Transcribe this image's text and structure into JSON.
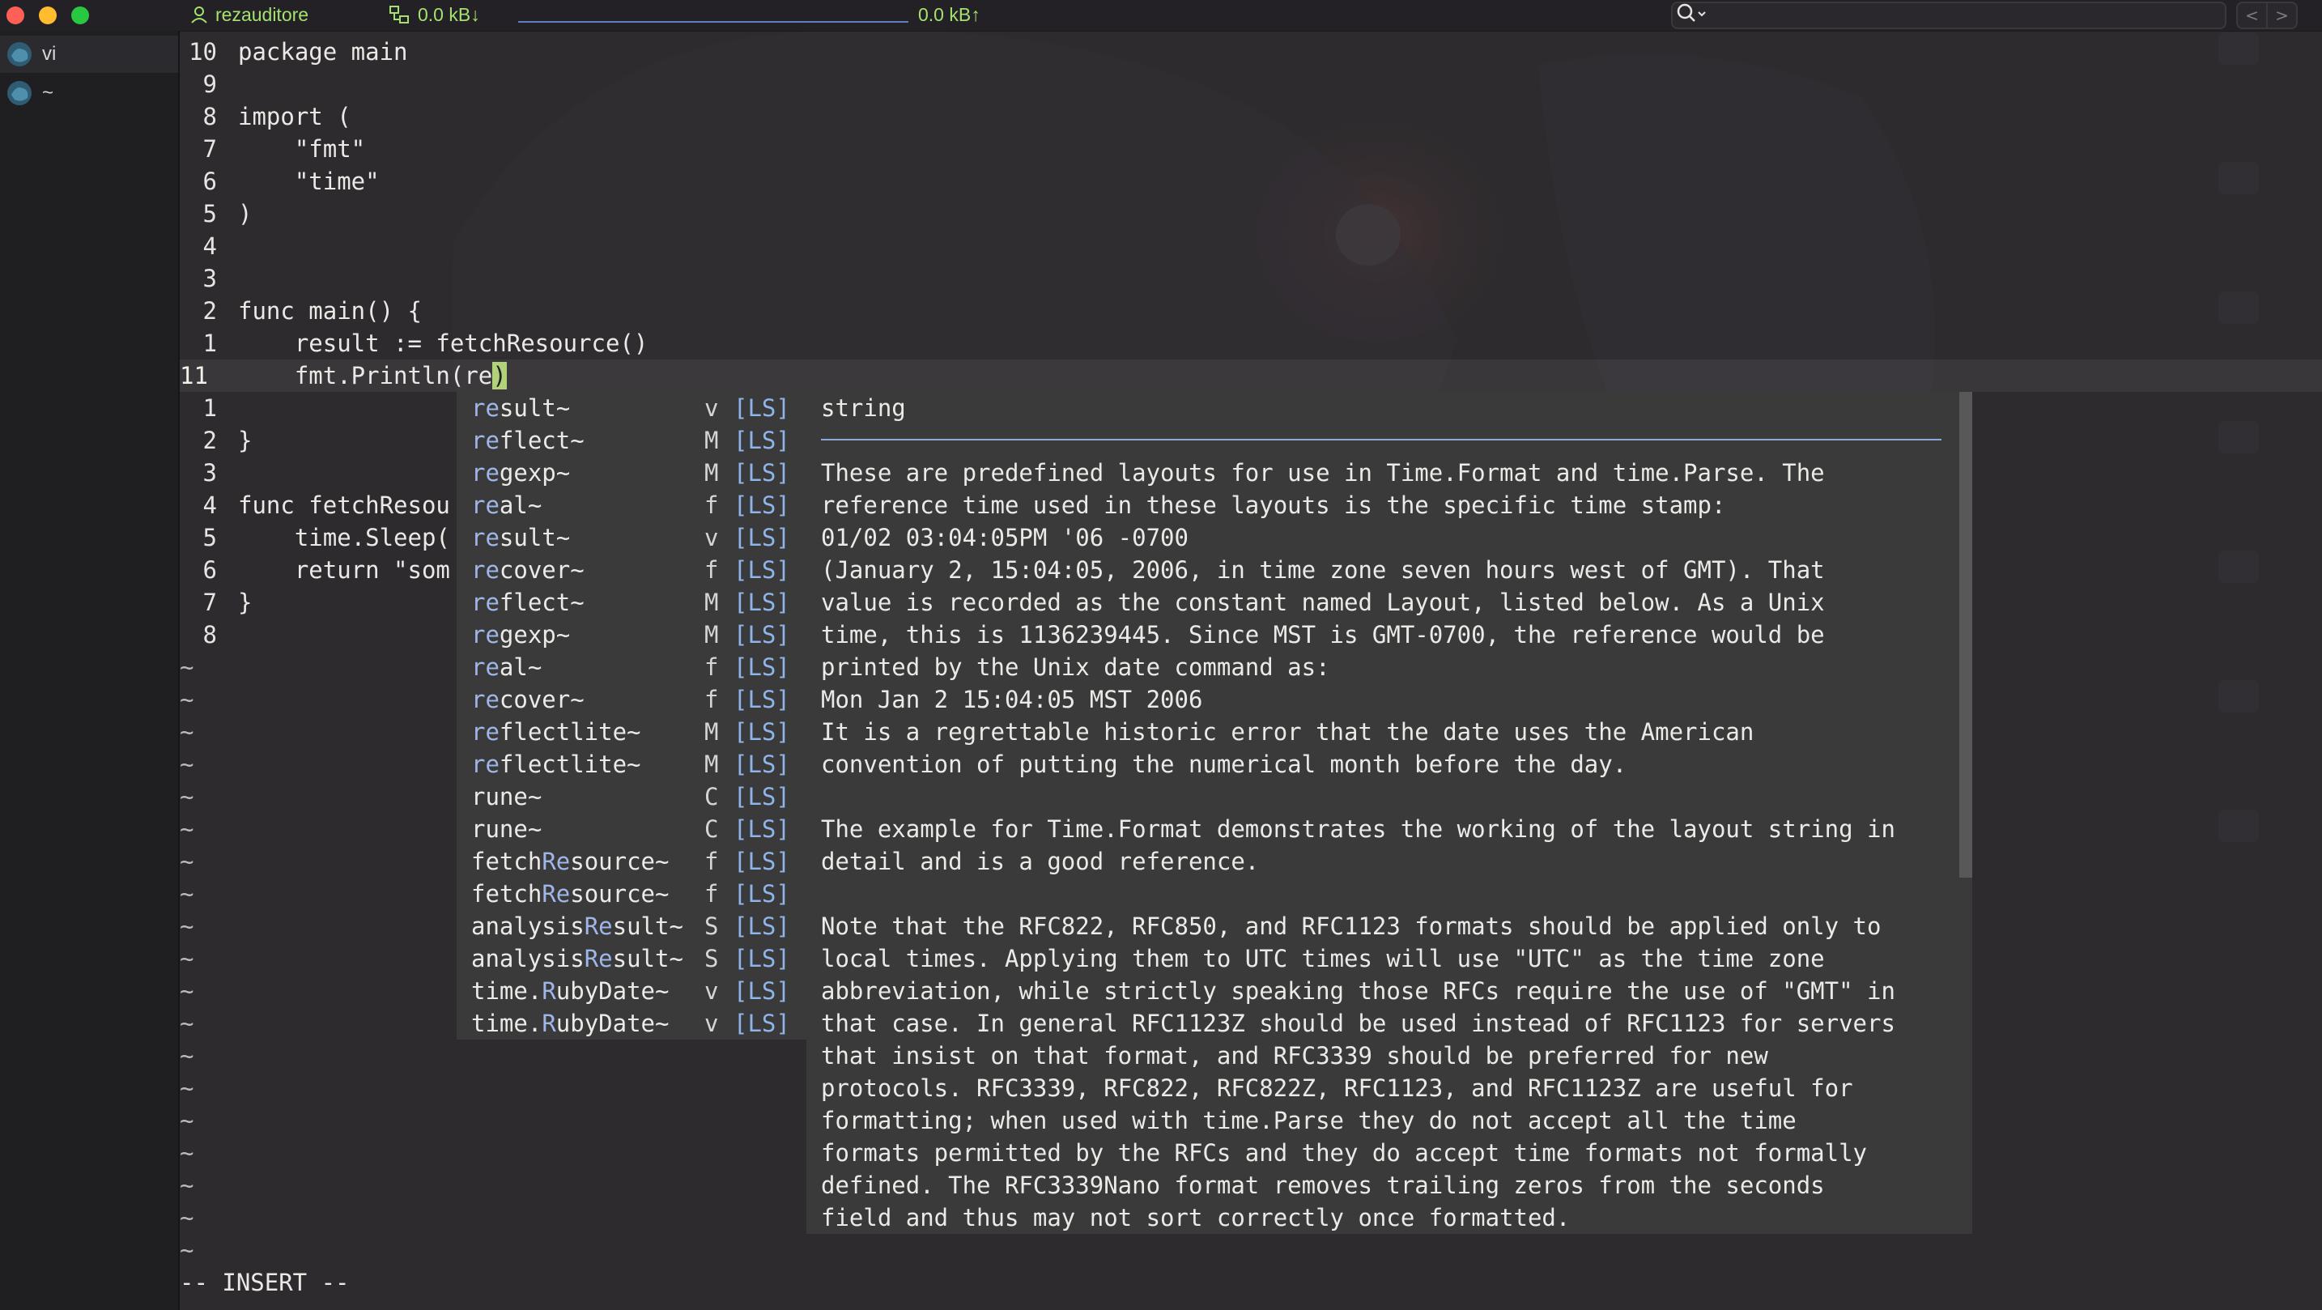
{
  "titlebar": {
    "user": "rezauditore",
    "net_down": "0.0 kB↓",
    "net_up": "0.0 kB↑",
    "nav_back": "<",
    "nav_forward": ">"
  },
  "sidebar": {
    "items": [
      {
        "label": "vi",
        "active": true
      },
      {
        "label": "~",
        "active": false
      }
    ]
  },
  "editor": {
    "lines": [
      {
        "num": "10",
        "code": "package main"
      },
      {
        "num": "9",
        "code": ""
      },
      {
        "num": "8",
        "code": "import ("
      },
      {
        "num": "7",
        "code": "    \"fmt\""
      },
      {
        "num": "6",
        "code": "    \"time\""
      },
      {
        "num": "5",
        "code": ")"
      },
      {
        "num": "4",
        "code": ""
      },
      {
        "num": "3",
        "code": ""
      },
      {
        "num": "2",
        "code": "func main() {"
      },
      {
        "num": "1",
        "code": "    result := fetchResource()"
      },
      {
        "num": "11",
        "code_before": "    fmt.Println(re",
        "code_paren": ")",
        "current": true
      },
      {
        "num": "1",
        "code": ""
      },
      {
        "num": "2",
        "code": "}"
      },
      {
        "num": "3",
        "code": ""
      },
      {
        "num": "4",
        "code": "func fetchResou"
      },
      {
        "num": "5",
        "code": "    time.Sleep("
      },
      {
        "num": "6",
        "code": "    return \"som"
      },
      {
        "num": "7",
        "code": "}"
      },
      {
        "num": "8",
        "code": ""
      }
    ],
    "tilde": "~",
    "tilde_count": 19,
    "mode": "-- INSERT --"
  },
  "completion": {
    "items": [
      {
        "pre": "",
        "hl": "re",
        "post": "sult~",
        "kind": "v",
        "src": "[LS]"
      },
      {
        "pre": "",
        "hl": "re",
        "post": "flect~",
        "kind": "M",
        "src": "[LS]"
      },
      {
        "pre": "",
        "hl": "re",
        "post": "gexp~",
        "kind": "M",
        "src": "[LS]"
      },
      {
        "pre": "",
        "hl": "re",
        "post": "al~",
        "kind": "f",
        "src": "[LS]"
      },
      {
        "pre": "",
        "hl": "re",
        "post": "sult~",
        "kind": "v",
        "src": "[LS]"
      },
      {
        "pre": "",
        "hl": "re",
        "post": "cover~",
        "kind": "f",
        "src": "[LS]"
      },
      {
        "pre": "",
        "hl": "re",
        "post": "flect~",
        "kind": "M",
        "src": "[LS]"
      },
      {
        "pre": "",
        "hl": "re",
        "post": "gexp~",
        "kind": "M",
        "src": "[LS]"
      },
      {
        "pre": "",
        "hl": "re",
        "post": "al~",
        "kind": "f",
        "src": "[LS]"
      },
      {
        "pre": "",
        "hl": "re",
        "post": "cover~",
        "kind": "f",
        "src": "[LS]"
      },
      {
        "pre": "",
        "hl": "re",
        "post": "flectlite~",
        "kind": "M",
        "src": "[LS]"
      },
      {
        "pre": "",
        "hl": "re",
        "post": "flectlite~",
        "kind": "M",
        "src": "[LS]"
      },
      {
        "pre": "ru",
        "hl": "",
        "post": "ne~",
        "kind": "C",
        "src": "[LS]"
      },
      {
        "pre": "ru",
        "hl": "",
        "post": "ne~",
        "kind": "C",
        "src": "[LS]"
      },
      {
        "pre": "fetch",
        "hl": "Re",
        "post": "source~",
        "kind": "f",
        "src": "[LS]"
      },
      {
        "pre": "fetch",
        "hl": "Re",
        "post": "source~",
        "kind": "f",
        "src": "[LS]"
      },
      {
        "pre": "analysis",
        "hl": "Re",
        "post": "sult~",
        "kind": "S",
        "src": "[LS]"
      },
      {
        "pre": "analysis",
        "hl": "Re",
        "post": "sult~",
        "kind": "S",
        "src": "[LS]"
      },
      {
        "pre": "time.",
        "hl": "R",
        "post": "ubyDate~",
        "kind": "v",
        "src": "[LS]"
      },
      {
        "pre": "time.",
        "hl": "R",
        "post": "ubyDate~",
        "kind": "v",
        "src": "[LS]"
      }
    ]
  },
  "doc": {
    "type": "string",
    "lines": [
      "These are predefined layouts for use in Time.Format and time.Parse. The",
      "reference time used in these layouts is the specific time stamp:",
      "01/02 03:04:05PM '06 -0700",
      "(January 2, 15:04:05, 2006, in time zone seven hours west of GMT). That",
      "value is recorded as the constant named Layout, listed below. As a Unix",
      "time, this is 1136239445. Since MST is GMT-0700, the reference would be",
      "printed by the Unix date command as:",
      "Mon Jan 2 15:04:05 MST 2006",
      "It is a regrettable historic error that the date uses the American",
      "convention of putting the numerical month before the day.",
      "",
      "The example for Time.Format demonstrates the working of the layout string in",
      "detail and is a good reference.",
      "",
      "Note that the RFC822, RFC850, and RFC1123 formats should be applied only to",
      "local times. Applying them to UTC times will use \"UTC\" as the time zone",
      "abbreviation, while strictly speaking those RFCs require the use of \"GMT\" in",
      "that case. In general RFC1123Z should be used instead of RFC1123 for servers",
      "that insist on that format, and RFC3339 should be preferred for new",
      "protocols. RFC3339, RFC822, RFC822Z, RFC1123, and RFC1123Z are useful for",
      "formatting; when used with time.Parse they do not accept all the time",
      "formats permitted by the RFCs and they do accept time formats not formally",
      "defined. The RFC3339Nano format removes trailing zeros from the seconds",
      "field and thus may not sort correctly once formatted."
    ]
  },
  "colors": {
    "user_text": "#a4e26f",
    "completion_match": "#9fb6e8",
    "source_tag": "#8fb4e9",
    "popup_bg": "#3a3a3a",
    "paren_match": "#b2d27a"
  }
}
